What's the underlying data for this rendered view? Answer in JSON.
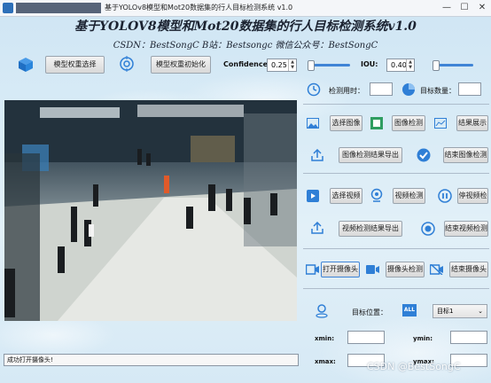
{
  "window": {
    "title": "基于YOLOv8模型和Mot20数据集的行人目标检测系统 v1.0",
    "controls": {
      "minimize": "—",
      "maximize": "☐",
      "close": "✕"
    }
  },
  "header": {
    "title": "基于YOLOV8模型和Mot20数据集的行人目标检测系统v1.0",
    "subtitle": "CSDN：BestSongC   B站：Bestsongc   微信公众号：BestSongC"
  },
  "toolbar": {
    "model_select": "模型权重选择",
    "model_init": "模型权重初始化",
    "confidence_label": "Confidence:",
    "confidence_value": "0.25",
    "iou_label": "IOU:",
    "iou_value": "0.40",
    "confidence_slider": 0.25,
    "iou_slider": 0.4
  },
  "stats": {
    "time_label": "检测用时：",
    "time_value": "",
    "count_label": "目标数量：",
    "count_value": ""
  },
  "image_section": {
    "select": "选择图像",
    "detect": "图像检测",
    "show": "结果展示",
    "export": "图像检测结果导出",
    "stop": "结束图像检测"
  },
  "video_section": {
    "select": "选择视频",
    "detect": "视频检测",
    "pause": "停视频检",
    "export": "视频检测结果导出",
    "stop": "结束视频检测"
  },
  "camera_section": {
    "open": "打开摄像头",
    "detect": "摄像头检测",
    "stop": "结束摄像头"
  },
  "position": {
    "label": "目标位置：",
    "all_badge": "ALL",
    "target_select": "目标1",
    "xmin_label": "xmin:",
    "ymin_label": "ymin:",
    "xmax_label": "xmax:",
    "ymax_label": "ymax:",
    "xmin": "",
    "ymin": "",
    "xmax": "",
    "ymax": ""
  },
  "status_bar": "成功打开摄像头!",
  "watermark": "CSDN @BestSongC",
  "colors": {
    "accent": "#2f7fd6",
    "slider": "#3f84d6",
    "header_text": "#1b2230"
  }
}
